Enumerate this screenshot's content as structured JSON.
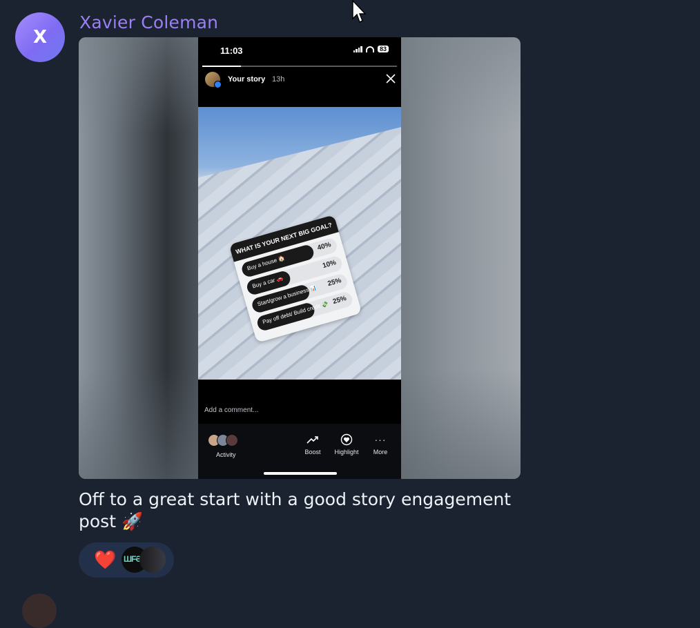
{
  "post": {
    "author_initial": "X",
    "author_name": "Xavier Coleman",
    "caption": "Off to a great start with a good story engagement post 🚀"
  },
  "story": {
    "status_time": "11:03",
    "battery": "83",
    "title": "Your story",
    "age": "13h",
    "progress": 0.2,
    "poll": {
      "question": "WHAT IS YOUR NEXT BIG GOAL?",
      "options": [
        {
          "label": "Buy a house 🏠",
          "percent": "40%",
          "fill": 0.4
        },
        {
          "label": "Buy a car 🚗",
          "percent": "10%",
          "fill": 0.1
        },
        {
          "label": "Start/grow a business 📊",
          "percent": "25%",
          "fill": 0.25
        },
        {
          "label": "Pay off debt/ Build credit 💸",
          "percent": "25%",
          "fill": 0.25
        }
      ]
    },
    "comment_placeholder": "Add a comment...",
    "toolbar": {
      "activity": "Activity",
      "boost": "Boost",
      "highlight": "Highlight",
      "more": "More"
    }
  },
  "reactions": {
    "emoji": "❤️",
    "reactor_badge": "ШFƏB"
  }
}
